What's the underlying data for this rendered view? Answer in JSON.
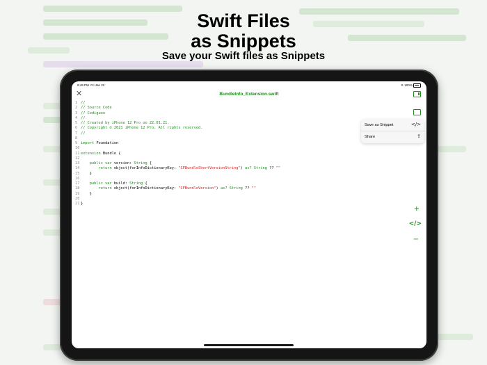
{
  "headline": {
    "title_line1": "Swift Files",
    "title_line2": "as Snippets",
    "subtitle": "Save your Swift files as Snippets"
  },
  "status_bar": {
    "time": "9:49 PM",
    "date": "Fri Jan 22",
    "battery": "100%"
  },
  "editor": {
    "file_name": "BundleInfo_Extension.swift"
  },
  "code_lines": [
    [
      {
        "t": "//",
        "c": "c-com"
      }
    ],
    [
      {
        "t": "// Source Code",
        "c": "c-com"
      }
    ],
    [
      {
        "t": "// Codigueo",
        "c": "c-com"
      }
    ],
    [
      {
        "t": "//",
        "c": "c-com"
      }
    ],
    [
      {
        "t": "// Created by iPhone 12 Pro on 22.01.21.",
        "c": "c-com"
      }
    ],
    [
      {
        "t": "// Copyright © 2021 iPhone 12 Pro. All rights reserved.",
        "c": "c-com"
      }
    ],
    [
      {
        "t": "//",
        "c": "c-com"
      }
    ],
    [],
    [
      {
        "t": "import",
        "c": "c-kw"
      },
      {
        "t": " Foundation",
        "c": ""
      }
    ],
    [],
    [
      {
        "t": "extension",
        "c": "c-kw"
      },
      {
        "t": " Bundle {",
        "c": ""
      }
    ],
    [],
    [
      {
        "t": "    ",
        "c": ""
      },
      {
        "t": "public var",
        "c": "c-kw"
      },
      {
        "t": " version: ",
        "c": ""
      },
      {
        "t": "String",
        "c": "c-type"
      },
      {
        "t": " {",
        "c": ""
      }
    ],
    [
      {
        "t": "        ",
        "c": ""
      },
      {
        "t": "return",
        "c": "c-kw"
      },
      {
        "t": " object(forInfoDictionaryKey: ",
        "c": ""
      },
      {
        "t": "\"CFBundleShortVersionString\"",
        "c": "c-str"
      },
      {
        "t": ") ",
        "c": ""
      },
      {
        "t": "as?",
        "c": "c-kw"
      },
      {
        "t": " ",
        "c": ""
      },
      {
        "t": "String",
        "c": "c-type"
      },
      {
        "t": " ?? ",
        "c": ""
      },
      {
        "t": "\"\"",
        "c": "c-str"
      }
    ],
    [
      {
        "t": "    }",
        "c": ""
      }
    ],
    [],
    [
      {
        "t": "    ",
        "c": ""
      },
      {
        "t": "public var",
        "c": "c-kw"
      },
      {
        "t": " build: ",
        "c": ""
      },
      {
        "t": "String",
        "c": "c-type"
      },
      {
        "t": " {",
        "c": ""
      }
    ],
    [
      {
        "t": "        ",
        "c": ""
      },
      {
        "t": "return",
        "c": "c-kw"
      },
      {
        "t": " object(forInfoDictionaryKey: ",
        "c": ""
      },
      {
        "t": "\"CFBundleVersion\"",
        "c": "c-str"
      },
      {
        "t": ") ",
        "c": ""
      },
      {
        "t": "as?",
        "c": "c-kw"
      },
      {
        "t": " ",
        "c": ""
      },
      {
        "t": "String",
        "c": "c-type"
      },
      {
        "t": " ?? ",
        "c": ""
      },
      {
        "t": "\"\"",
        "c": "c-str"
      }
    ],
    [
      {
        "t": "    }",
        "c": ""
      }
    ],
    [],
    [
      {
        "t": "}",
        "c": ""
      }
    ]
  ],
  "context_menu": {
    "items": [
      {
        "label": "Save as Snippet",
        "icon": "code-brackets-icon",
        "glyph": "</>"
      },
      {
        "label": "Share",
        "icon": "share-icon",
        "glyph": "⇪"
      }
    ]
  },
  "side_tools": {
    "plus": "+",
    "snippet": "</>",
    "minus": "−"
  },
  "colors": {
    "accent": "#1e8b1e",
    "string": "#d21c1c",
    "device": "#151515"
  }
}
